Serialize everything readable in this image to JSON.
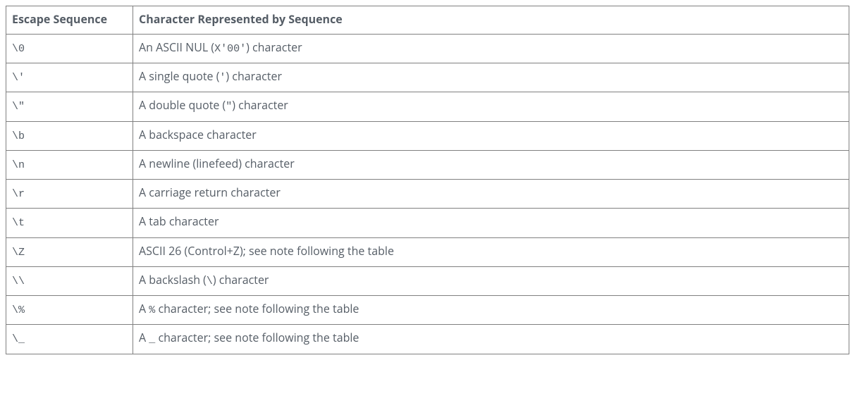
{
  "table": {
    "headers": {
      "col1": "Escape Sequence",
      "col2": "Character Represented by Sequence"
    },
    "rows": [
      {
        "seq": "\\0",
        "pre": "An ASCII NUL (",
        "code": "X'00'",
        "post": ") character"
      },
      {
        "seq": "\\'",
        "pre": "A single quote (",
        "code": "'",
        "post": ") character"
      },
      {
        "seq": "\\\"",
        "pre": "A double quote (",
        "code": "\"",
        "post": ") character"
      },
      {
        "seq": "\\b",
        "pre": "A backspace character",
        "code": "",
        "post": ""
      },
      {
        "seq": "\\n",
        "pre": "A newline (linefeed) character",
        "code": "",
        "post": ""
      },
      {
        "seq": "\\r",
        "pre": "A carriage return character",
        "code": "",
        "post": ""
      },
      {
        "seq": "\\t",
        "pre": "A tab character",
        "code": "",
        "post": ""
      },
      {
        "seq": "\\Z",
        "pre": "ASCII 26 (Control+Z); see note following the table",
        "code": "",
        "post": ""
      },
      {
        "seq": "\\\\",
        "pre": "A backslash (",
        "code": "\\",
        "post": ") character"
      },
      {
        "seq": "\\%",
        "pre": "A ",
        "code": "%",
        "post": " character; see note following the table"
      },
      {
        "seq": "\\_",
        "pre": "A ",
        "code": "_",
        "post": " character; see note following the table"
      }
    ]
  }
}
